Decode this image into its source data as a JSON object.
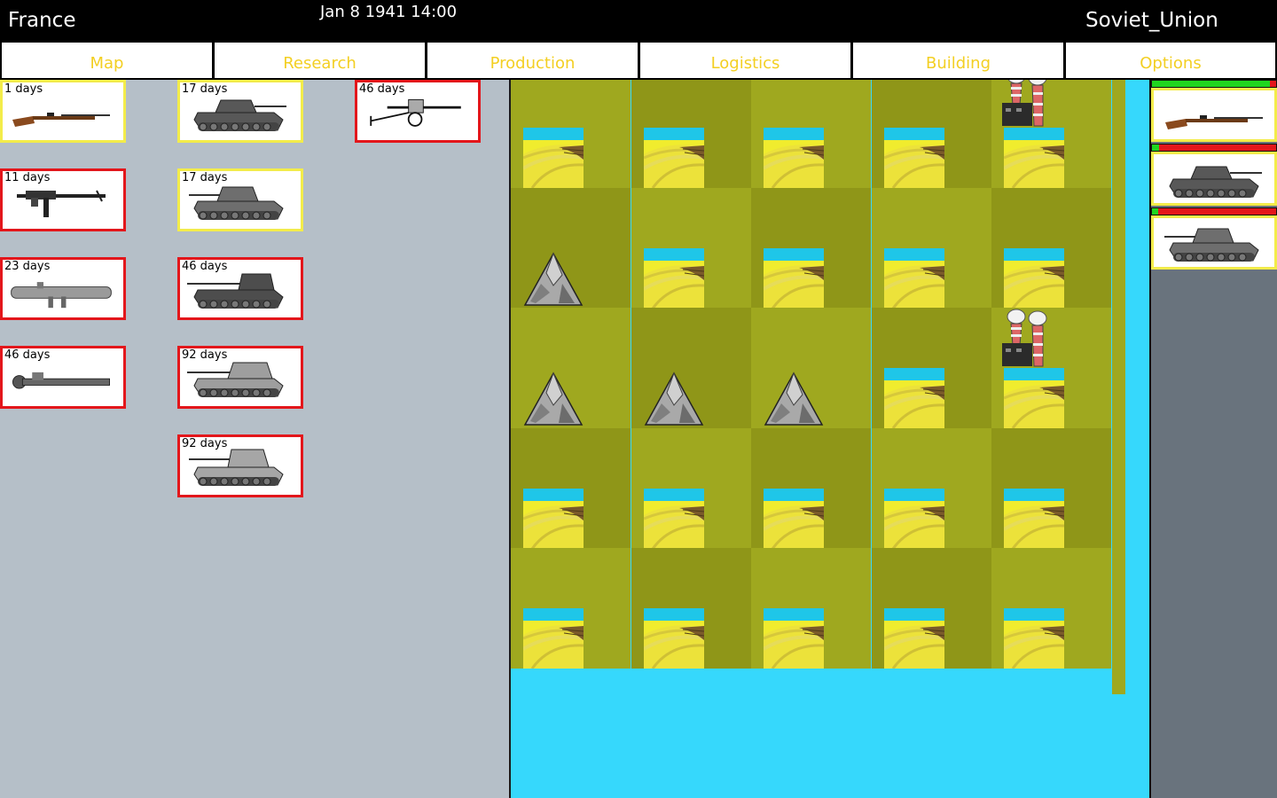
{
  "header": {
    "player_country": "France",
    "datetime": "Jan 8 1941  14:00",
    "opponent_country": "Soviet_Union"
  },
  "tabs": [
    {
      "label": "Map"
    },
    {
      "label": "Research"
    },
    {
      "label": "Production"
    },
    {
      "label": "Logistics"
    },
    {
      "label": "Building"
    },
    {
      "label": "Options"
    }
  ],
  "research": {
    "columns": [
      [
        {
          "days": "1 days",
          "icon": "rifle-icon",
          "status": "available"
        },
        {
          "days": "11 days",
          "icon": "submachine-gun-icon",
          "status": "locked"
        },
        {
          "days": "23 days",
          "icon": "bazooka-icon",
          "status": "locked"
        },
        {
          "days": "46 days",
          "icon": "panzerschreck-icon",
          "status": "locked"
        }
      ],
      [
        {
          "days": "17 days",
          "icon": "light-tank-icon",
          "status": "available"
        },
        {
          "days": "17 days",
          "icon": "medium-tank-icon",
          "status": "available"
        },
        {
          "days": "46 days",
          "icon": "panther-tank-icon",
          "status": "locked"
        },
        {
          "days": "92 days",
          "icon": "king-tiger-tank-icon",
          "status": "locked"
        },
        {
          "days": "92 days",
          "icon": "tiger-tank-icon",
          "status": "locked"
        }
      ],
      [
        {
          "days": "46 days",
          "icon": "anti-tank-gun-icon",
          "status": "locked"
        }
      ]
    ]
  },
  "map": {
    "rows": [
      [
        "farmland",
        "farmland",
        "farmland",
        "farmland",
        "farmland-factory"
      ],
      [
        "mountain",
        "farmland",
        "farmland",
        "farmland",
        "farmland"
      ],
      [
        "mountain",
        "mountain",
        "mountain",
        "farmland",
        "farmland-factory"
      ],
      [
        "farmland",
        "farmland",
        "farmland",
        "farmland",
        "farmland"
      ],
      [
        "farmland",
        "farmland",
        "farmland",
        "farmland",
        "farmland"
      ]
    ],
    "colors": {
      "grass": "#9fa81f",
      "grass_dark": "#8f9618",
      "water": "#36d8fc",
      "field": "#f0ec2e"
    }
  },
  "production_queue": [
    {
      "icon": "rifle-icon",
      "progress": 0.95
    },
    {
      "icon": "light-tank-icon",
      "progress": 0.06
    },
    {
      "icon": "medium-tank-icon",
      "progress": 0.05
    }
  ]
}
